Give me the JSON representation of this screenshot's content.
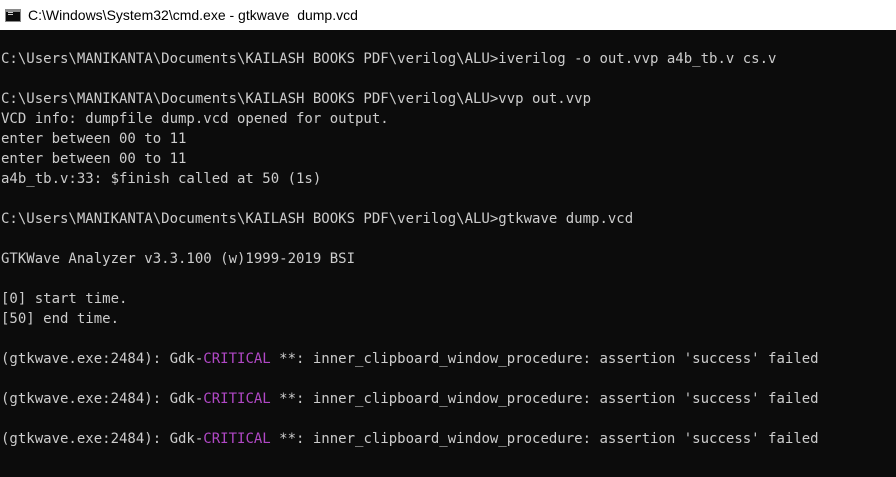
{
  "window": {
    "title": "C:\\Windows\\System32\\cmd.exe - gtkwave  dump.vcd",
    "icon": "cmd-console-icon"
  },
  "colors": {
    "background": "#0c0c0c",
    "foreground": "#cccccc",
    "critical": "#b148c6",
    "titlebar": "#ffffff"
  },
  "console": {
    "lines": [
      "C:\\Users\\MANIKANTA\\Documents\\KAILASH BOOKS PDF\\verilog\\ALU>iverilog -o out.vvp a4b_tb.v cs.v",
      "",
      "C:\\Users\\MANIKANTA\\Documents\\KAILASH BOOKS PDF\\verilog\\ALU>vvp out.vvp",
      "VCD info: dumpfile dump.vcd opened for output.",
      "enter between 00 to 11",
      "enter between 00 to 11",
      "a4b_tb.v:33: $finish called at 50 (1s)",
      "",
      "C:\\Users\\MANIKANTA\\Documents\\KAILASH BOOKS PDF\\verilog\\ALU>gtkwave dump.vcd",
      "",
      "GTKWave Analyzer v3.3.100 (w)1999-2019 BSI",
      "",
      "[0] start time.",
      "[50] end time.",
      ""
    ],
    "critical_messages": [
      {
        "prefix": "(gtkwave.exe:2484): Gdk-",
        "level": "CRITICAL",
        "suffix": " **: inner_clipboard_window_procedure: assertion 'success' failed"
      },
      {
        "prefix": "(gtkwave.exe:2484): Gdk-",
        "level": "CRITICAL",
        "suffix": " **: inner_clipboard_window_procedure: assertion 'success' failed"
      },
      {
        "prefix": "(gtkwave.exe:2484): Gdk-",
        "level": "CRITICAL",
        "suffix": " **: inner_clipboard_window_procedure: assertion 'success' failed"
      }
    ]
  }
}
